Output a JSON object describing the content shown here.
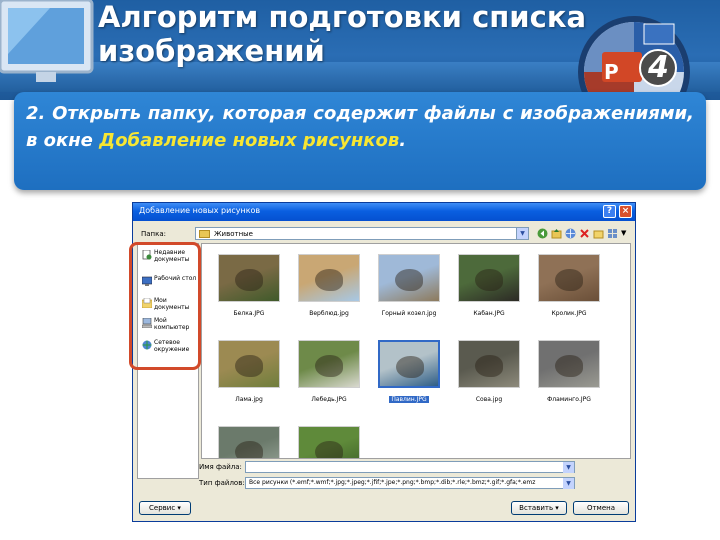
{
  "slide": {
    "title": "Алгоритм подготовки списка изображений",
    "badge_number": "4",
    "badge_letter": "P"
  },
  "instruction": {
    "text_before": "2. Открыть папку, которая содержит файлы с изображениями, в окне ",
    "highlight": "Добавление новых рисунков",
    "text_after": "."
  },
  "dialog": {
    "title": "Добавление новых рисунков",
    "folder_label": "Папка:",
    "folder_value": "Животные",
    "places": [
      {
        "label": "Недавние документы",
        "icon": "recent-documents-icon"
      },
      {
        "label": "Рабочий стол",
        "icon": "desktop-icon"
      },
      {
        "label": "Мои документы",
        "icon": "my-documents-icon"
      },
      {
        "label": "Мой компьютер",
        "icon": "my-computer-icon"
      },
      {
        "label": "Сетевое окружение",
        "icon": "network-places-icon"
      }
    ],
    "files": [
      {
        "name": "Белка.JPG",
        "colors": [
          "#7a6a45",
          "#3f5a2a"
        ]
      },
      {
        "name": "Верблюд.jpg",
        "colors": [
          "#c9a774",
          "#a7c8e6"
        ]
      },
      {
        "name": "Горный козел.jpg",
        "colors": [
          "#9fb9d8",
          "#8d7a5c"
        ]
      },
      {
        "name": "Кабан.JPG",
        "colors": [
          "#4d6a3b",
          "#2c2a25"
        ]
      },
      {
        "name": "Кролик.JPG",
        "colors": [
          "#8f7156",
          "#6a4f38"
        ]
      },
      {
        "name": "Лама.jpg",
        "colors": [
          "#9c8a52",
          "#6f7e3c"
        ]
      },
      {
        "name": "Лебедь.JPG",
        "colors": [
          "#6e8a49",
          "#d9d9cf"
        ]
      },
      {
        "name": "Павлин.JPG",
        "colors": [
          "#b3c2c9",
          "#2f5e86"
        ],
        "selected": true
      },
      {
        "name": "Сова.jpg",
        "colors": [
          "#5a5a4f",
          "#8d8a7b"
        ]
      },
      {
        "name": "Фламинго.JPG",
        "colors": [
          "#707070",
          "#9a9a92"
        ]
      },
      {
        "name": "",
        "colors": [
          "#6b7a6b",
          "#9aa79b"
        ]
      },
      {
        "name": "",
        "colors": [
          "#5f8a3a",
          "#3c5e27"
        ]
      }
    ],
    "filename_label": "Имя файла:",
    "filename_value": "",
    "filetype_label": "Тип файлов:",
    "filetype_value": "Все рисунки (*.emf;*.wmf;*.jpg;*.jpeg;*.jfif;*.jpe;*.png;*.bmp;*.dib;*.rle;*.bmz;*.gif;*.gfa;*.emz",
    "service_button": "Сервис",
    "insert_button": "Вставить",
    "cancel_button": "Отмена",
    "help_glyph": "?",
    "close_glyph": "×"
  }
}
